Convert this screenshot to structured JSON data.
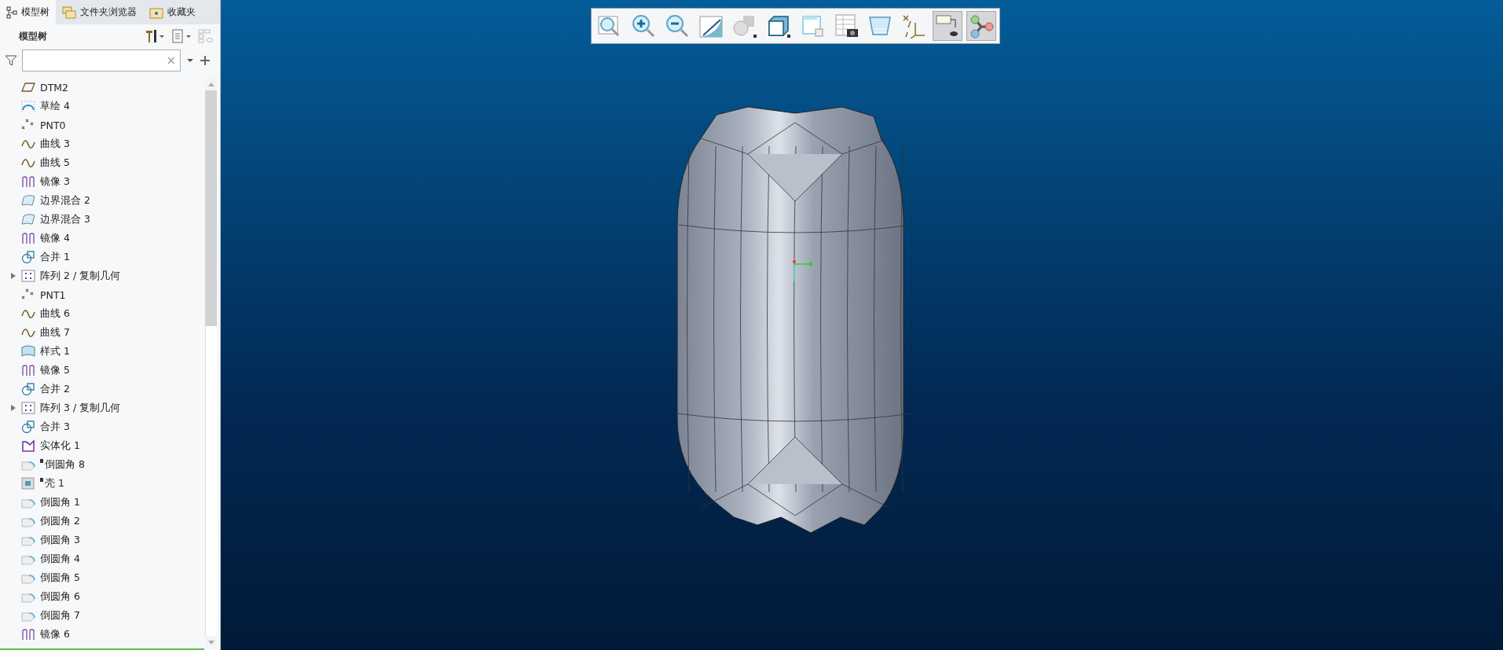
{
  "panel_tabs": [
    {
      "label": "模型树",
      "kind": "tree",
      "selected": true
    },
    {
      "label": "文件夹浏览器",
      "kind": "folders",
      "selected": false
    },
    {
      "label": "收藏夹",
      "kind": "favorites",
      "selected": false
    }
  ],
  "tree_header": {
    "title": "模型树"
  },
  "filter": {
    "clear": "×"
  },
  "tree_items": [
    {
      "label": "DTM2",
      "kind": "datum-plane",
      "flagged": false
    },
    {
      "label": "草绘 4",
      "kind": "sketch",
      "flagged": false
    },
    {
      "label": "PNT0",
      "kind": "point",
      "flagged": false
    },
    {
      "label": "曲线 3",
      "kind": "curve",
      "flagged": false
    },
    {
      "label": "曲线 5",
      "kind": "curve",
      "flagged": false
    },
    {
      "label": "镜像 3",
      "kind": "mirror",
      "flagged": false
    },
    {
      "label": "边界混合 2",
      "kind": "blend",
      "flagged": false
    },
    {
      "label": "边界混合 3",
      "kind": "blend",
      "flagged": false
    },
    {
      "label": "镜像 4",
      "kind": "mirror",
      "flagged": false
    },
    {
      "label": "合并 1",
      "kind": "merge",
      "flagged": false
    },
    {
      "label": "阵列 2 / 复制几何",
      "kind": "pattern",
      "flagged": false,
      "expanded": false
    },
    {
      "label": "PNT1",
      "kind": "point",
      "flagged": false
    },
    {
      "label": "曲线 6",
      "kind": "curve",
      "flagged": false
    },
    {
      "label": "曲线 7",
      "kind": "curve",
      "flagged": false
    },
    {
      "label": "样式 1",
      "kind": "style",
      "flagged": false
    },
    {
      "label": "镜像 5",
      "kind": "mirror",
      "flagged": false
    },
    {
      "label": "合并 2",
      "kind": "merge",
      "flagged": false
    },
    {
      "label": "阵列 3 / 复制几何",
      "kind": "pattern",
      "flagged": false,
      "expanded": false
    },
    {
      "label": "合并 3",
      "kind": "merge",
      "flagged": false
    },
    {
      "label": "实体化 1",
      "kind": "solidify",
      "flagged": false
    },
    {
      "label": "倒圆角 8",
      "kind": "round",
      "flagged": true
    },
    {
      "label": "壳 1",
      "kind": "shell",
      "flagged": true
    },
    {
      "label": "倒圆角 1",
      "kind": "round",
      "flagged": false
    },
    {
      "label": "倒圆角 2",
      "kind": "round",
      "flagged": false
    },
    {
      "label": "倒圆角 3",
      "kind": "round",
      "flagged": false
    },
    {
      "label": "倒圆角 4",
      "kind": "round",
      "flagged": false
    },
    {
      "label": "倒圆角 5",
      "kind": "round",
      "flagged": false
    },
    {
      "label": "倒圆角 6",
      "kind": "round",
      "flagged": false
    },
    {
      "label": "倒圆角 7",
      "kind": "round",
      "flagged": false
    },
    {
      "label": "镜像 6",
      "kind": "mirror",
      "flagged": false
    }
  ],
  "view_toolbar": [
    {
      "kind": "refit",
      "on": false
    },
    {
      "kind": "zoom-in",
      "on": false
    },
    {
      "kind": "zoom-out",
      "on": false
    },
    {
      "kind": "repaint",
      "on": false
    },
    {
      "kind": "display-style",
      "on": false
    },
    {
      "kind": "saved-views",
      "on": false
    },
    {
      "kind": "view-manager",
      "on": false
    },
    {
      "kind": "snapshot",
      "on": false
    },
    {
      "kind": "perspective",
      "on": false
    },
    {
      "kind": "datum-display",
      "on": false
    },
    {
      "kind": "annotation-display",
      "on": true
    },
    {
      "kind": "spin-center",
      "on": true
    }
  ]
}
